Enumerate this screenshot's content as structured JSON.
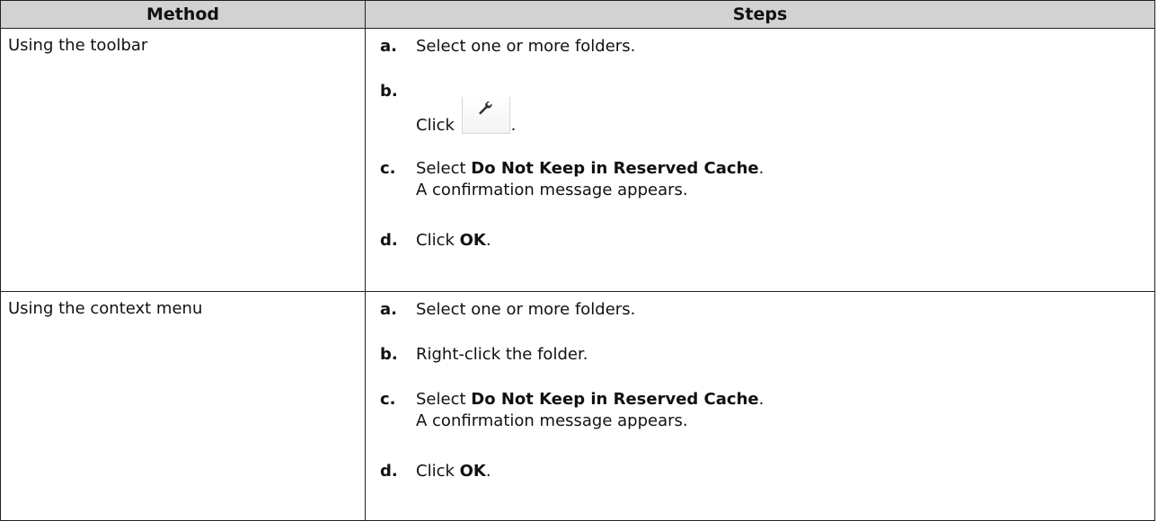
{
  "table": {
    "headers": {
      "method": "Method",
      "steps": "Steps"
    },
    "rows": [
      {
        "method": "Using the toolbar",
        "steps": [
          {
            "letter": "a.",
            "text": "Select one or more folders."
          },
          {
            "letter": "b.",
            "pre": "Click",
            "post": ".",
            "icon": "wrench-icon"
          },
          {
            "letter": "c.",
            "pre": "Select",
            "bold": "Do Not Keep in Reserved Cache",
            "post": ".",
            "sub": "A confirmation message appears."
          },
          {
            "letter": "d.",
            "pre": "Click",
            "bold": "OK",
            "post": "."
          }
        ]
      },
      {
        "method": "Using the context menu",
        "steps": [
          {
            "letter": "a.",
            "text": "Select one or more folders."
          },
          {
            "letter": "b.",
            "text": "Right-click the folder."
          },
          {
            "letter": "c.",
            "pre": "Select",
            "bold": "Do Not Keep in Reserved Cache",
            "post": ".",
            "sub": "A confirmation message appears."
          },
          {
            "letter": "d.",
            "pre": "Click",
            "bold": "OK",
            "post": "."
          }
        ]
      }
    ]
  }
}
